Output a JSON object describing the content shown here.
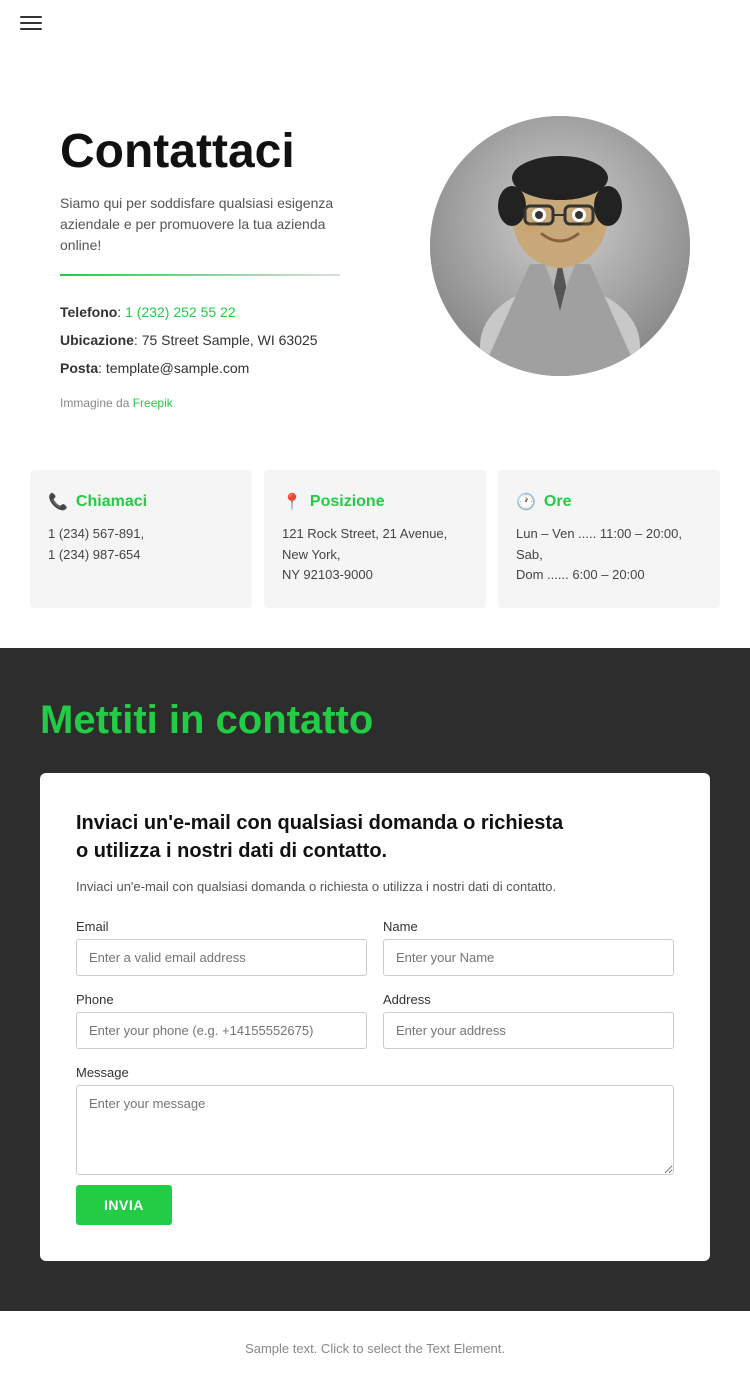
{
  "header": {
    "menu_icon": "hamburger-icon"
  },
  "hero": {
    "title": "Contattaci",
    "subtitle": "Siamo qui per soddisfare qualsiasi esigenza aziendale e per promuovere la tua azienda online!",
    "phone_label": "Telefono",
    "phone_number": "1 (232) 252 55 22",
    "location_label": "Ubicazione",
    "location_value": "75 Street Sample, WI 63025",
    "email_label": "Posta",
    "email_value": "template@sample.com",
    "image_credit_prefix": "Immagine da",
    "image_credit_link": "Freepik"
  },
  "info_cards": [
    {
      "id": "call",
      "icon": "📞",
      "title": "Chiamaci",
      "line1": "1 (234) 567-891,",
      "line2": "1 (234) 987-654"
    },
    {
      "id": "location",
      "icon": "📍",
      "title": "Posizione",
      "line1": "121 Rock Street, 21 Avenue, New York,",
      "line2": "NY 92103-9000"
    },
    {
      "id": "hours",
      "icon": "🕐",
      "title": "Ore",
      "line1": "Lun – Ven ..... 11:00 – 20:00, Sab,",
      "line2": "Dom ...... 6:00 – 20:00"
    }
  ],
  "contact_section": {
    "title": "Mettiti in contatto",
    "form_card": {
      "title_line1": "Inviaci un'e-mail con qualsiasi domanda o richiesta",
      "title_line2": "o utilizza i nostri dati di contatto.",
      "description": "Inviaci un'e-mail con qualsiasi domanda o richiesta o utilizza i nostri dati di contatto.",
      "fields": {
        "email_label": "Email",
        "email_placeholder": "Enter a valid email address",
        "name_label": "Name",
        "name_placeholder": "Enter your Name",
        "phone_label": "Phone",
        "phone_placeholder": "Enter your phone (e.g. +14155552675)",
        "address_label": "Address",
        "address_placeholder": "Enter your address",
        "message_label": "Message",
        "message_placeholder": "Enter your message"
      },
      "submit_label": "INVIA"
    }
  },
  "footer": {
    "text": "Sample text. Click to select the Text Element."
  }
}
